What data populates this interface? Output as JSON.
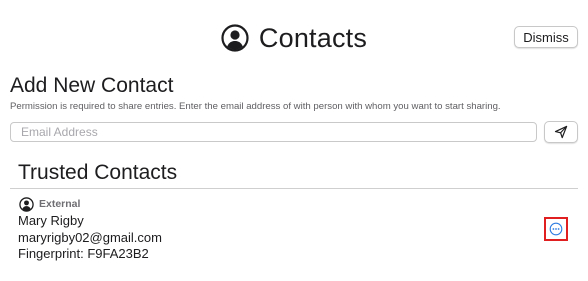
{
  "header": {
    "title": "Contacts",
    "dismiss_label": "Dismiss"
  },
  "add_contact": {
    "heading": "Add New Contact",
    "description": "Permission is required to share entries. Enter the email address of with person with whom you want to start sharing.",
    "email_placeholder": "Email Address",
    "send_icon": "paper-plane-icon"
  },
  "trusted": {
    "heading": "Trusted Contacts",
    "contacts": [
      {
        "type": "External",
        "name": "Mary Rigby",
        "email": "maryrigby02@gmail.com",
        "fingerprint": "Fingerprint: F9FA23B2",
        "more_icon": "ellipsis-circle-icon"
      }
    ]
  },
  "colors": {
    "accent": "#2f7de1",
    "highlight": "#e02020",
    "text": "#1d1d1f",
    "muted": "#6e6e73"
  }
}
